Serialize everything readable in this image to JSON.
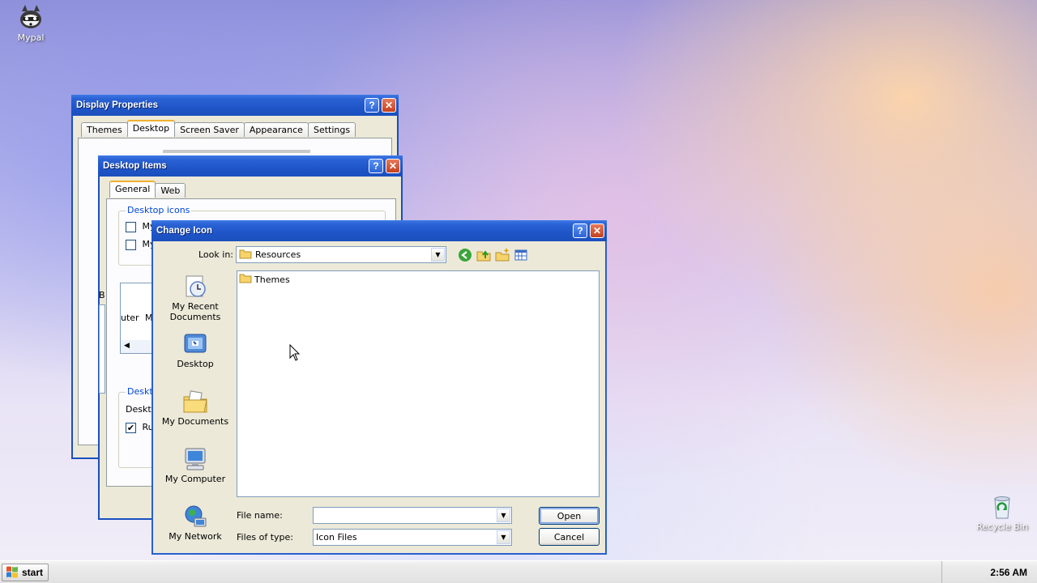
{
  "desktop": {
    "icons": [
      {
        "label": "Mypal",
        "icon": "mypal-raccoon-icon"
      },
      {
        "label": "Recycle Bin",
        "icon": "recycle-bin-icon"
      }
    ]
  },
  "display_properties": {
    "title": "Display Properties",
    "tabs": [
      "Themes",
      "Desktop",
      "Screen Saver",
      "Appearance",
      "Settings"
    ],
    "active_tab": "Desktop"
  },
  "desktop_items": {
    "title": "Desktop Items",
    "tabs": [
      "General",
      "Web"
    ],
    "active_tab": "General",
    "group_desktop_icons": "Desktop icons",
    "checkbox_1": "My",
    "checkbox_2": "My",
    "partial_b": "B",
    "icon_strip_text_1": "uter",
    "icon_strip_text_2": "M",
    "group_desktop_cleanup": "Deskto",
    "cleanup_text": "Deskto",
    "run_checkbox": "Ru"
  },
  "change_icon": {
    "title": "Change Icon",
    "look_in_label": "Look in:",
    "look_in_value": "Resources",
    "places": [
      {
        "label": "My Recent Documents",
        "icon": "recent-documents-icon"
      },
      {
        "label": "Desktop",
        "icon": "desktop-icon"
      },
      {
        "label": "My Documents",
        "icon": "my-documents-icon"
      },
      {
        "label": "My Computer",
        "icon": "my-computer-icon"
      },
      {
        "label": "My Network",
        "icon": "my-network-icon"
      }
    ],
    "files": [
      {
        "name": "Themes",
        "icon": "folder-icon"
      }
    ],
    "file_name_label": "File name:",
    "file_name_value": "",
    "files_of_type_label": "Files of type:",
    "files_of_type_value": "Icon Files",
    "open_button": "Open",
    "cancel_button": "Cancel",
    "toolbar": [
      "back-icon",
      "up-folder-icon",
      "new-folder-icon",
      "view-menu-icon"
    ]
  },
  "taskbar": {
    "start_label": "start",
    "clock": "2:56 AM"
  },
  "colors": {
    "title_bar": "#1f55c8",
    "dialog_face": "#ece9d8",
    "taskbar": "#e6e6e6"
  }
}
